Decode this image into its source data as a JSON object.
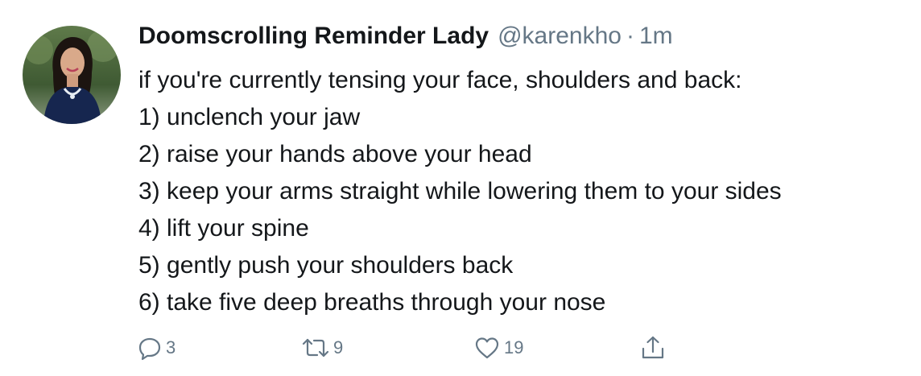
{
  "tweet": {
    "author_name": "Doomscrolling Reminder Lady",
    "handle": "@karenkho",
    "separator": "·",
    "time": "1m",
    "lines": [
      "if you're currently tensing your face, shoulders and back:",
      "1) unclench your jaw",
      "2) raise your hands above your head",
      "3) keep your arms straight while lowering them to your sides",
      "4) lift your spine",
      "5) gently push your shoulders back",
      "6) take five deep breaths through your nose"
    ],
    "actions": {
      "reply": {
        "icon": "reply-icon",
        "count": "3"
      },
      "retweet": {
        "icon": "retweet-icon",
        "count": "9"
      },
      "like": {
        "icon": "heart-icon",
        "count": "19"
      },
      "share": {
        "icon": "share-icon",
        "count": ""
      }
    }
  },
  "colors": {
    "text": "#14171a",
    "secondary": "#657786",
    "background": "#ffffff"
  }
}
